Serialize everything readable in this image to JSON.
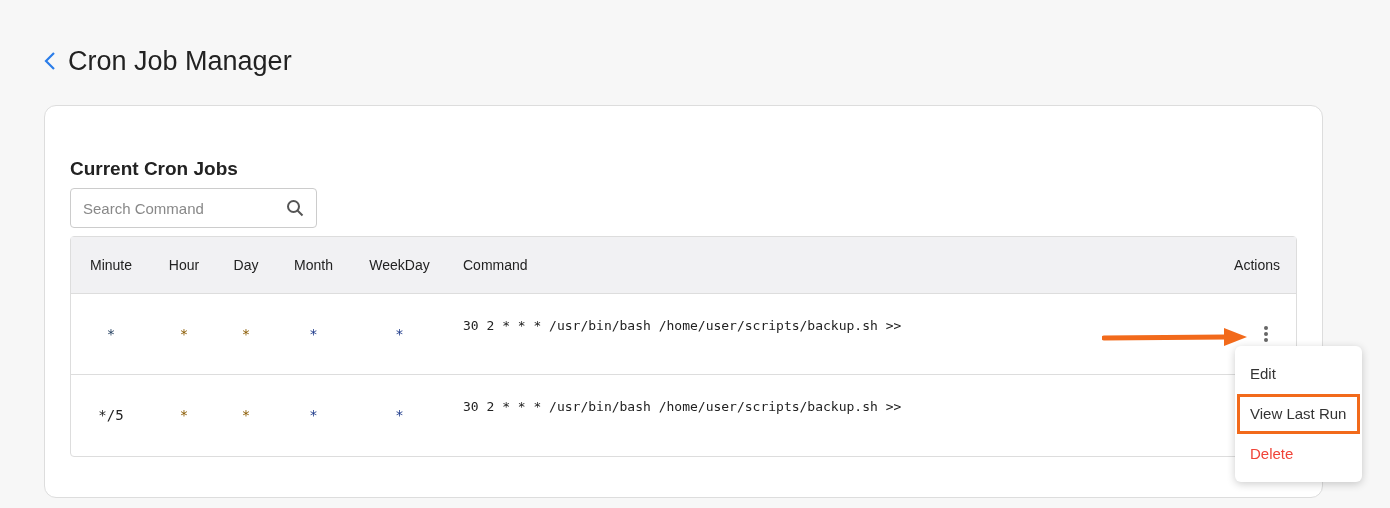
{
  "page": {
    "title": "Cron Job Manager"
  },
  "section": {
    "title": "Current Cron Jobs"
  },
  "search": {
    "placeholder": "Search Command"
  },
  "table": {
    "columns": [
      "Minute",
      "Hour",
      "Day",
      "Month",
      "WeekDay",
      "Command",
      "Actions"
    ],
    "rows": [
      {
        "cells": [
          "*",
          "*",
          "*",
          "*",
          "*",
          "30 2 * * * /usr/bin/bash /home/user/scripts/backup.sh >>"
        ],
        "menu_open": true
      },
      {
        "cells": [
          "*/5",
          "*",
          "*",
          "*",
          "*",
          "30 2 * * * /usr/bin/bash /home/user/scripts/backup.sh >>"
        ],
        "menu_open": false
      }
    ]
  },
  "menu": {
    "items": [
      {
        "label": "Edit",
        "kind": "normal",
        "highlighted": false
      },
      {
        "label": "View Last Run",
        "kind": "normal",
        "highlighted": true
      },
      {
        "label": "Delete",
        "kind": "danger",
        "highlighted": false
      }
    ]
  }
}
